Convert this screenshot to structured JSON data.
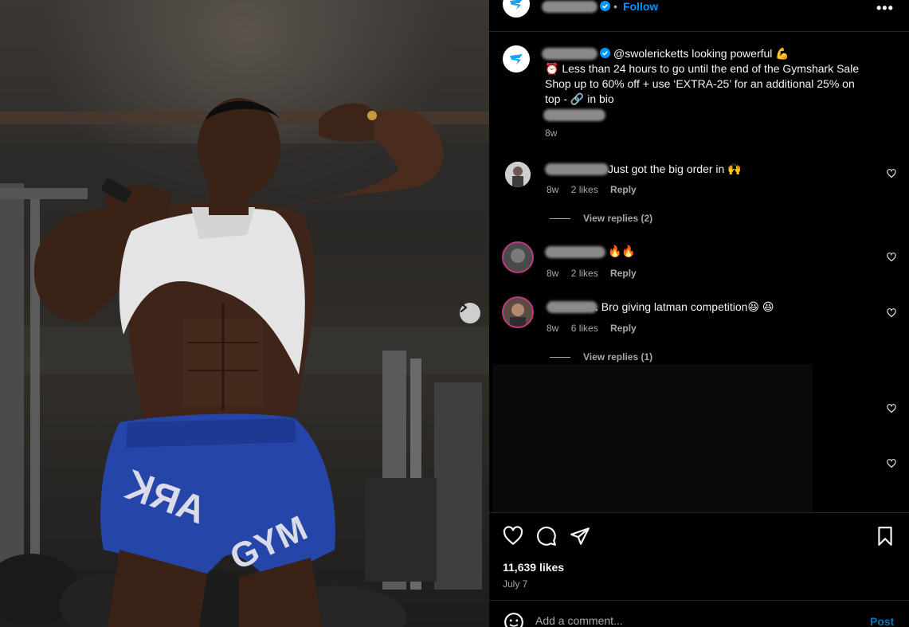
{
  "header": {
    "follow_label": "Follow",
    "more_label": "•••",
    "verified_icon": "verified-badge-icon"
  },
  "caption": {
    "mention": "@swolericketts looking powerful 💪",
    "line1": "⏰ Less than 24 hours to go until the end of the Gymshark Sale",
    "line2": "Shop up to 60% off + use ‘EXTRA-25’ for an additional 25% on",
    "line3": "top - 🔗 in bio",
    "time": "8w"
  },
  "comments": [
    {
      "text": "Just got the big order in 🙌",
      "time": "8w",
      "likes": "2 likes",
      "reply": "Reply",
      "view_replies": "View replies (2)"
    },
    {
      "text": "🔥🔥",
      "time": "8w",
      "likes": "2 likes",
      "reply": "Reply"
    },
    {
      "text": ". Bro giving latman competition😆 😆",
      "time": "8w",
      "likes": "6 likes",
      "reply": "Reply",
      "view_replies": "View replies (1)"
    }
  ],
  "actions": {
    "likes": "11,639 likes",
    "date": "July 7"
  },
  "add_comment": {
    "placeholder": "Add a comment...",
    "post_label": "Post"
  },
  "colors": {
    "accent": "#0095f6",
    "background": "#000000",
    "muted": "#a8a8a8"
  }
}
